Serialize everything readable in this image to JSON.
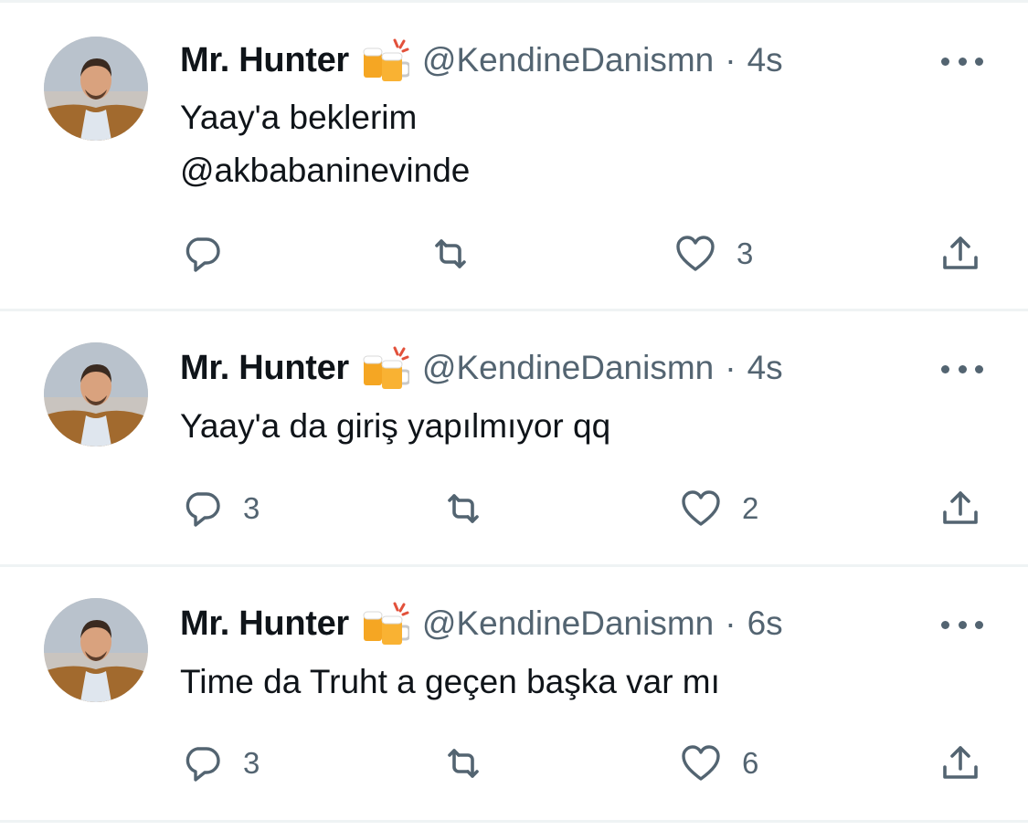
{
  "colors": {
    "text": "#0f1419",
    "secondary": "#536471",
    "divider": "#eff3f4"
  },
  "icons": {
    "reply": "reply-icon",
    "retweet": "retweet-icon",
    "like": "heart-icon",
    "share": "share-icon",
    "more": "more-icon",
    "badge": "beer-mugs-emoji"
  },
  "tweets": [
    {
      "name": "Mr. Hunter",
      "handle": "@KendineDanismn",
      "separator": "·",
      "time": "4s",
      "lines": [
        "Yaay'a beklerim",
        "@akbabaninevinde"
      ],
      "replies": "",
      "retweets": "",
      "likes": "3"
    },
    {
      "name": "Mr. Hunter",
      "handle": "@KendineDanismn",
      "separator": "·",
      "time": "4s",
      "lines": [
        "Yaay'a da giriş yapılmıyor qq"
      ],
      "replies": "3",
      "retweets": "",
      "likes": "2"
    },
    {
      "name": "Mr. Hunter",
      "handle": "@KendineDanismn",
      "separator": "·",
      "time": "6s",
      "lines": [
        "Time da Truht a geçen başka var mı"
      ],
      "replies": "3",
      "retweets": "",
      "likes": "6"
    }
  ]
}
